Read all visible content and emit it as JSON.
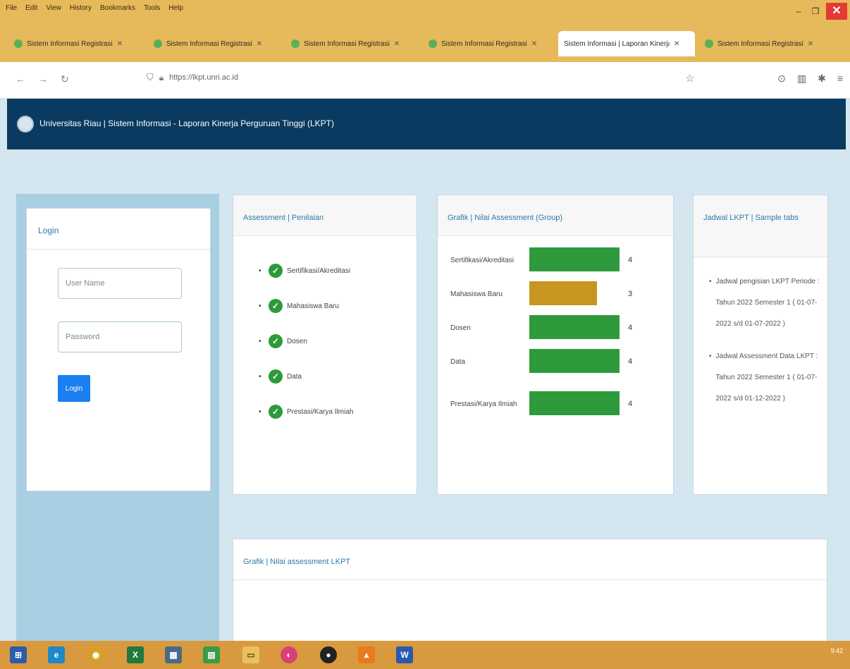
{
  "browser": {
    "menu": [
      "File",
      "Edit",
      "View",
      "History",
      "Bookmarks",
      "Tools",
      "Help"
    ],
    "tabs": [
      {
        "label": "Sistem Informasi Registrasi",
        "active": false
      },
      {
        "label": "Sistem Informasi Registrasi",
        "active": false
      },
      {
        "label": "Sistem Informasi Registrasi",
        "active": false
      },
      {
        "label": "Sistem Informasi Registrasi",
        "active": false
      },
      {
        "label": "Sistem Informasi | Laporan Kinerja",
        "active": true
      },
      {
        "label": "Sistem Informasi Registrasi",
        "active": false
      }
    ],
    "url": "https://lkpt.unri.ac.id"
  },
  "header": {
    "title": "Universitas Riau | Sistem Informasi - Laporan Kinerja Perguruan Tinggi (LKPT)"
  },
  "login": {
    "title": "Login",
    "username_placeholder": "User Name",
    "password_placeholder": "Password",
    "button_label": "Login"
  },
  "assessment": {
    "title": "Assessment | Penilaian",
    "items": [
      "Sertifikasi/Akreditasi",
      "Mahasiswa Baru",
      "Dosen",
      "Data",
      "Prestasi/Karya Ilmiah"
    ]
  },
  "group_chart": {
    "title": "Grafik | Nilai Assessment (Group)"
  },
  "chart_data": {
    "type": "bar",
    "orientation": "horizontal",
    "categories": [
      "Sertifikasi/Akreditasi",
      "Mahasiswa Baru",
      "Dosen",
      "Data",
      "Prestasi/Karya Ilmiah"
    ],
    "values": [
      4,
      3,
      4,
      4,
      4
    ],
    "xlim": [
      0,
      4
    ],
    "colors": [
      "#2e9a3c",
      "#c8961e",
      "#2e9a3c",
      "#2e9a3c",
      "#2e9a3c"
    ],
    "data_labels": true,
    "grid": false
  },
  "jadwal": {
    "title": "Jadwal LKPT | Sample tabs",
    "items": [
      "Jadwal pengisian LKPT Periode : Tahun 2022 Semester 1 ( 01-07-2022 s/d 01-07-2022 )",
      "Jadwal Assessment Data LKPT : Tahun 2022 Semester 1 ( 01-07-2022 s/d 01-12-2022 )"
    ]
  },
  "bottom_chart": {
    "title": "Grafik | Nilai assessment LKPT"
  },
  "taskbar": {
    "icons": [
      "start-icon",
      "ie-icon",
      "chrome-icon",
      "excel-icon",
      "app-icon",
      "file-icon",
      "folder-icon",
      "firefox-icon",
      "media-icon",
      "vlc-icon",
      "word-icon"
    ],
    "time": "9:42"
  },
  "colors": {
    "header_bg": "#0a3a5f",
    "chrome_bg": "#e6b95a",
    "sidebar_bg": "#a8cfe2",
    "page_bg": "#d4e6ef",
    "primary": "#1a7ff0",
    "success": "#2e9a3c",
    "warning": "#c8961e"
  }
}
